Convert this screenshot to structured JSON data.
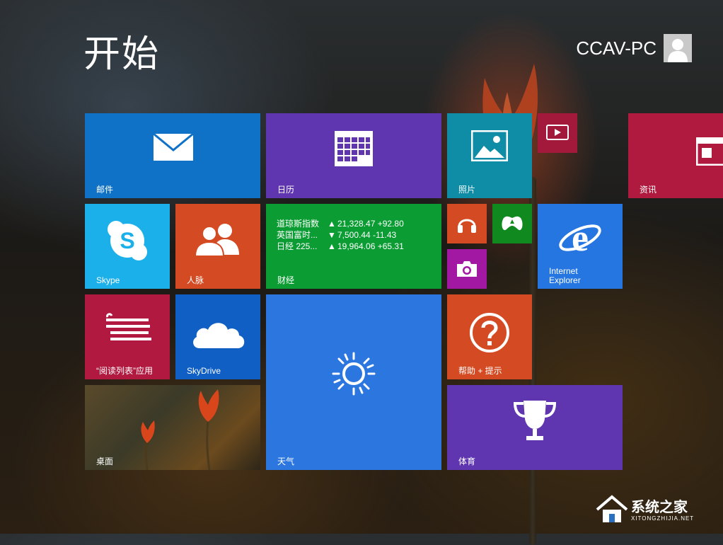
{
  "header": {
    "title": "开始",
    "user_name": "CCAV-PC"
  },
  "colors": {
    "mail": "#0f72c7",
    "calendar": "#5f36b0",
    "photos": "#0f8da6",
    "video": "#a3193b",
    "news": "#b01a3f",
    "skype": "#1bb0e9",
    "people": "#d44a22",
    "finance": "#0b9d33",
    "music": "#d44a22",
    "games": "#10891e",
    "camera": "#a218a2",
    "ie": "#2576e0",
    "reading": "#b11940",
    "skydrive": "#0f5fc4",
    "weather": "#2c76df",
    "help": "#d44a22",
    "sports": "#5f36b0"
  },
  "tiles": {
    "mail": {
      "label": "邮件",
      "icon": "mail-icon"
    },
    "calendar": {
      "label": "日历",
      "icon": "calendar-icon"
    },
    "photos": {
      "label": "照片",
      "icon": "photos-icon"
    },
    "video": {
      "icon": "video-icon"
    },
    "news": {
      "label": "资讯",
      "icon": "news-icon"
    },
    "skype": {
      "label": "Skype",
      "icon": "skype-icon"
    },
    "people": {
      "label": "人脉",
      "icon": "people-icon"
    },
    "finance": {
      "label": "财经",
      "rows": [
        {
          "name": "道琼斯指数",
          "arrow": "▲",
          "value": "21,328.47 +92.80"
        },
        {
          "name": "英国富时...",
          "arrow": "▼",
          "value": "7,500.44 -11.43"
        },
        {
          "name": "日经 225...",
          "arrow": "▲",
          "value": "19,964.06 +65.31"
        }
      ]
    },
    "music": {
      "icon": "headphones-icon"
    },
    "games": {
      "icon": "gamepad-icon"
    },
    "camera": {
      "icon": "camera-icon"
    },
    "ie": {
      "label_line1": "Internet",
      "label_line2": "Explorer",
      "icon": "ie-icon"
    },
    "reading": {
      "label": "“阅读列表”应用",
      "icon": "reading-list-icon"
    },
    "skydrive": {
      "label": "SkyDrive",
      "icon": "cloud-icon"
    },
    "weather": {
      "label": "天气",
      "icon": "sun-icon"
    },
    "help": {
      "label": "帮助 + 提示",
      "icon": "question-icon"
    },
    "desktop": {
      "label": "桌面"
    },
    "sports": {
      "label": "体育",
      "icon": "trophy-icon"
    }
  },
  "watermark": {
    "text": "系统之家",
    "sub": "XITONGZHIJIA.NET"
  }
}
